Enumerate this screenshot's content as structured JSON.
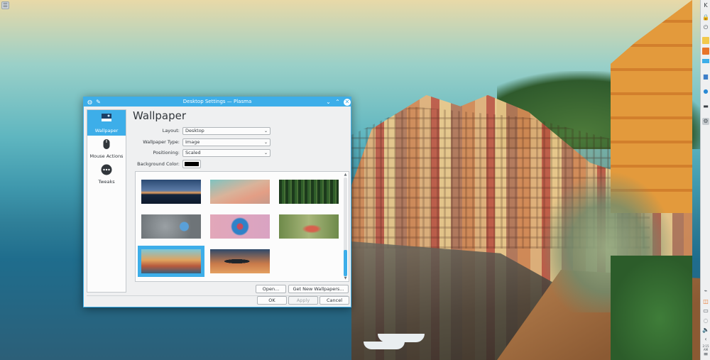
{
  "dialog": {
    "title": "Desktop Settings — Plasma",
    "heading": "Wallpaper",
    "sidebar": [
      {
        "label": "Wallpaper",
        "icon": "wallpaper-icon",
        "active": true
      },
      {
        "label": "Mouse Actions",
        "icon": "mouse-icon",
        "active": false
      },
      {
        "label": "Tweaks",
        "icon": "more-dots-icon",
        "active": false
      }
    ],
    "form": {
      "layout_label": "Layout:",
      "layout_value": "Desktop",
      "wallpaper_type_label": "Wallpaper Type:",
      "wallpaper_type_value": "Image",
      "positioning_label": "Positioning:",
      "positioning_value": "Scaled",
      "background_color_label": "Background Color:",
      "background_color": "#000000"
    },
    "thumbnails": [
      {
        "name": "sunset-bay",
        "selected": false
      },
      {
        "name": "pastel-clouds",
        "selected": false
      },
      {
        "name": "green-forest",
        "selected": false
      },
      {
        "name": "grey-gear",
        "selected": false
      },
      {
        "name": "blue-splash-on-pink",
        "selected": false
      },
      {
        "name": "red-leaves",
        "selected": false
      },
      {
        "name": "coastal-town",
        "selected": true
      },
      {
        "name": "airplane-dusk",
        "selected": false
      }
    ],
    "buttons": {
      "open": "Open...",
      "get_new": "Get New Wallpapers...",
      "ok": "OK",
      "apply": "Apply",
      "cancel": "Cancel"
    }
  },
  "colors": {
    "accent": "#3daee9",
    "window_bg": "#eff0f1",
    "text": "#31363b"
  },
  "panel": {
    "clock": "2:15 AM"
  }
}
